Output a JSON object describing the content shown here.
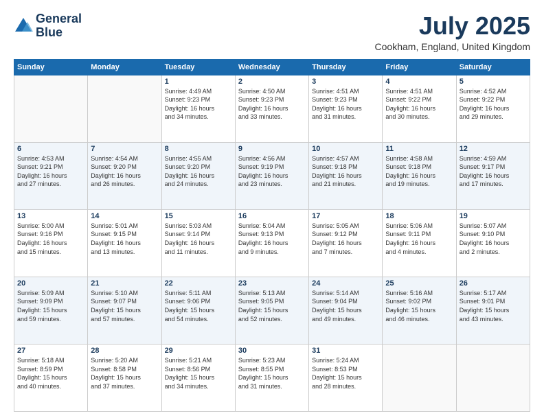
{
  "header": {
    "logo_line1": "General",
    "logo_line2": "Blue",
    "title": "July 2025",
    "location": "Cookham, England, United Kingdom"
  },
  "days_of_week": [
    "Sunday",
    "Monday",
    "Tuesday",
    "Wednesday",
    "Thursday",
    "Friday",
    "Saturday"
  ],
  "weeks": [
    [
      {
        "day": "",
        "info": ""
      },
      {
        "day": "",
        "info": ""
      },
      {
        "day": "1",
        "info": "Sunrise: 4:49 AM\nSunset: 9:23 PM\nDaylight: 16 hours\nand 34 minutes."
      },
      {
        "day": "2",
        "info": "Sunrise: 4:50 AM\nSunset: 9:23 PM\nDaylight: 16 hours\nand 33 minutes."
      },
      {
        "day": "3",
        "info": "Sunrise: 4:51 AM\nSunset: 9:23 PM\nDaylight: 16 hours\nand 31 minutes."
      },
      {
        "day": "4",
        "info": "Sunrise: 4:51 AM\nSunset: 9:22 PM\nDaylight: 16 hours\nand 30 minutes."
      },
      {
        "day": "5",
        "info": "Sunrise: 4:52 AM\nSunset: 9:22 PM\nDaylight: 16 hours\nand 29 minutes."
      }
    ],
    [
      {
        "day": "6",
        "info": "Sunrise: 4:53 AM\nSunset: 9:21 PM\nDaylight: 16 hours\nand 27 minutes."
      },
      {
        "day": "7",
        "info": "Sunrise: 4:54 AM\nSunset: 9:20 PM\nDaylight: 16 hours\nand 26 minutes."
      },
      {
        "day": "8",
        "info": "Sunrise: 4:55 AM\nSunset: 9:20 PM\nDaylight: 16 hours\nand 24 minutes."
      },
      {
        "day": "9",
        "info": "Sunrise: 4:56 AM\nSunset: 9:19 PM\nDaylight: 16 hours\nand 23 minutes."
      },
      {
        "day": "10",
        "info": "Sunrise: 4:57 AM\nSunset: 9:18 PM\nDaylight: 16 hours\nand 21 minutes."
      },
      {
        "day": "11",
        "info": "Sunrise: 4:58 AM\nSunset: 9:18 PM\nDaylight: 16 hours\nand 19 minutes."
      },
      {
        "day": "12",
        "info": "Sunrise: 4:59 AM\nSunset: 9:17 PM\nDaylight: 16 hours\nand 17 minutes."
      }
    ],
    [
      {
        "day": "13",
        "info": "Sunrise: 5:00 AM\nSunset: 9:16 PM\nDaylight: 16 hours\nand 15 minutes."
      },
      {
        "day": "14",
        "info": "Sunrise: 5:01 AM\nSunset: 9:15 PM\nDaylight: 16 hours\nand 13 minutes."
      },
      {
        "day": "15",
        "info": "Sunrise: 5:03 AM\nSunset: 9:14 PM\nDaylight: 16 hours\nand 11 minutes."
      },
      {
        "day": "16",
        "info": "Sunrise: 5:04 AM\nSunset: 9:13 PM\nDaylight: 16 hours\nand 9 minutes."
      },
      {
        "day": "17",
        "info": "Sunrise: 5:05 AM\nSunset: 9:12 PM\nDaylight: 16 hours\nand 7 minutes."
      },
      {
        "day": "18",
        "info": "Sunrise: 5:06 AM\nSunset: 9:11 PM\nDaylight: 16 hours\nand 4 minutes."
      },
      {
        "day": "19",
        "info": "Sunrise: 5:07 AM\nSunset: 9:10 PM\nDaylight: 16 hours\nand 2 minutes."
      }
    ],
    [
      {
        "day": "20",
        "info": "Sunrise: 5:09 AM\nSunset: 9:09 PM\nDaylight: 15 hours\nand 59 minutes."
      },
      {
        "day": "21",
        "info": "Sunrise: 5:10 AM\nSunset: 9:07 PM\nDaylight: 15 hours\nand 57 minutes."
      },
      {
        "day": "22",
        "info": "Sunrise: 5:11 AM\nSunset: 9:06 PM\nDaylight: 15 hours\nand 54 minutes."
      },
      {
        "day": "23",
        "info": "Sunrise: 5:13 AM\nSunset: 9:05 PM\nDaylight: 15 hours\nand 52 minutes."
      },
      {
        "day": "24",
        "info": "Sunrise: 5:14 AM\nSunset: 9:04 PM\nDaylight: 15 hours\nand 49 minutes."
      },
      {
        "day": "25",
        "info": "Sunrise: 5:16 AM\nSunset: 9:02 PM\nDaylight: 15 hours\nand 46 minutes."
      },
      {
        "day": "26",
        "info": "Sunrise: 5:17 AM\nSunset: 9:01 PM\nDaylight: 15 hours\nand 43 minutes."
      }
    ],
    [
      {
        "day": "27",
        "info": "Sunrise: 5:18 AM\nSunset: 8:59 PM\nDaylight: 15 hours\nand 40 minutes."
      },
      {
        "day": "28",
        "info": "Sunrise: 5:20 AM\nSunset: 8:58 PM\nDaylight: 15 hours\nand 37 minutes."
      },
      {
        "day": "29",
        "info": "Sunrise: 5:21 AM\nSunset: 8:56 PM\nDaylight: 15 hours\nand 34 minutes."
      },
      {
        "day": "30",
        "info": "Sunrise: 5:23 AM\nSunset: 8:55 PM\nDaylight: 15 hours\nand 31 minutes."
      },
      {
        "day": "31",
        "info": "Sunrise: 5:24 AM\nSunset: 8:53 PM\nDaylight: 15 hours\nand 28 minutes."
      },
      {
        "day": "",
        "info": ""
      },
      {
        "day": "",
        "info": ""
      }
    ]
  ]
}
